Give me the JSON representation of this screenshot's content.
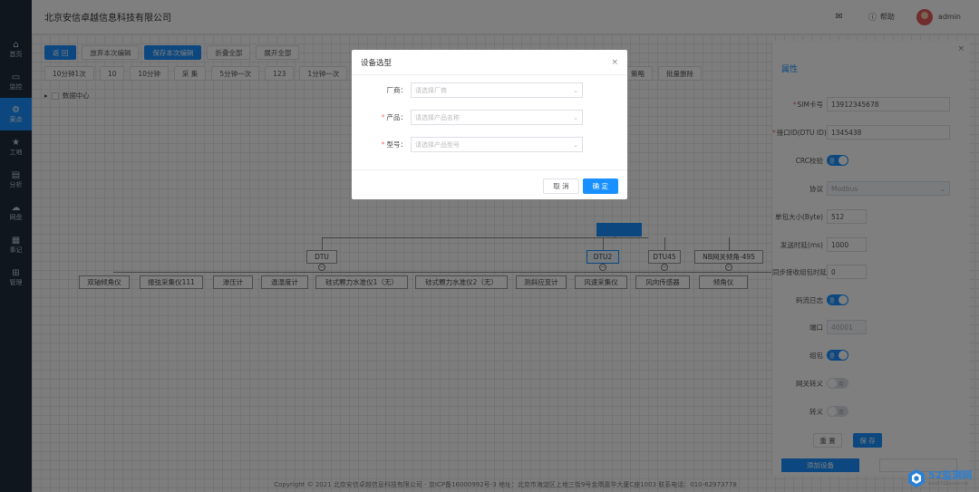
{
  "header": {
    "company": "北京安信卓越信息科技有限公司",
    "help_label": "帮助",
    "user": "admin"
  },
  "sidebar": {
    "items": [
      {
        "label": "首页",
        "icon": "home-icon"
      },
      {
        "label": "监控",
        "icon": "monitor-icon"
      },
      {
        "label": "采点",
        "icon": "gear-icon"
      },
      {
        "label": "工地",
        "icon": "star-icon"
      },
      {
        "label": "分析",
        "icon": "chart-icon"
      },
      {
        "label": "网盘",
        "icon": "cloud-icon"
      },
      {
        "label": "事记",
        "icon": "calendar-icon"
      },
      {
        "label": "管理",
        "icon": "grid-icon"
      }
    ],
    "active_index": 2
  },
  "toolbar": {
    "row1": [
      "返 回",
      "放弃本次编辑",
      "保存本次编辑",
      "折叠全部",
      "展开全部"
    ],
    "row2": [
      "10分钟1次",
      "10",
      "10分钟",
      "采 集",
      "5分钟一次",
      "123",
      "1分钟一次"
    ],
    "row2_right": [
      "策略",
      "批量删除"
    ]
  },
  "tree": {
    "root_label": "数据中心",
    "top_node": "",
    "dtu_nodes": [
      "DTU",
      "DTU2",
      "DTU45",
      "NB网关倾角-495"
    ],
    "leaf_nodes": [
      "双轴倾角仪",
      "振弦采集仪111",
      "渗压计",
      "温湿度计",
      "硅式颗力水准仪1（无）",
      "硅式颗力水准仪2（无）",
      "测斜应变计",
      "风速采集仪",
      "风向传感器",
      "倾角仪"
    ]
  },
  "panel": {
    "title": "属性",
    "fields": [
      {
        "label": "SIM卡号",
        "required": true,
        "value": "13912345678"
      },
      {
        "label": "接口ID(DTU ID)",
        "required": true,
        "value": "1345438"
      },
      {
        "label": "CRC校验",
        "type": "switch",
        "on": true,
        "state_text": "是"
      },
      {
        "label": "协议",
        "type": "select",
        "value": "Modbus"
      },
      {
        "label": "单包大小(Byte)",
        "value": "512"
      },
      {
        "label": "发送时延(ms)",
        "value": "1000"
      },
      {
        "label": "同步接收组包时延",
        "value": "0"
      },
      {
        "label": "码流日志",
        "type": "switch",
        "on": true,
        "state_text": "是"
      },
      {
        "label": "端口",
        "type": "input-disabled",
        "value": "40001"
      },
      {
        "label": "组包",
        "type": "switch",
        "on": true,
        "state_text": "是"
      },
      {
        "label": "网关转义",
        "type": "switch",
        "on": false,
        "state_text": "否"
      },
      {
        "label": "转义",
        "type": "switch",
        "on": false,
        "state_text": "否"
      }
    ],
    "reset_label": "重 置",
    "save_label": "保 存",
    "add_device_label": "添加设备"
  },
  "modal": {
    "title": "设备选型",
    "fields": [
      {
        "label": "厂商",
        "required": false,
        "placeholder": "请选择厂商"
      },
      {
        "label": "产品",
        "required": true,
        "placeholder": "请选择产品名称"
      },
      {
        "label": "型号",
        "required": true,
        "placeholder": "请选择产品型号"
      }
    ],
    "cancel_label": "取 消",
    "confirm_label": "确 定"
  },
  "footer": {
    "text": "Copyright © 2021 北京安信卓越信息科技有限公司 - 京ICP备16000992号-3 地址：北京市海淀区上地三街9号金隅嘉华大厦C座1003 联系电话：010-62973778"
  },
  "watermark": {
    "main": "52监测网",
    "sub": "www.52jiance.net"
  },
  "colors": {
    "primary": "#1890ff",
    "sidebar": "#1f2d3d",
    "required": "#f56c6c"
  }
}
